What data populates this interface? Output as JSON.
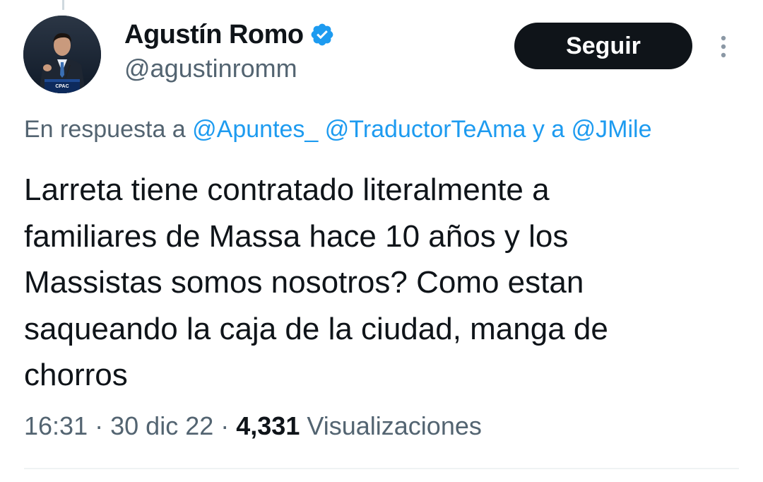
{
  "tweet": {
    "author": {
      "display_name": "Agustín Romo",
      "handle": "@agustinromm",
      "verified": true
    },
    "follow_label": "Seguir",
    "reply_prefix": "En respuesta a ",
    "reply_mentions": [
      "@Apuntes_",
      "@TraductorTeAma"
    ],
    "reply_conjunction": "y a",
    "reply_mention_last": "@JMile",
    "text": "Larreta tiene contratado literalmente a\nfamiliares de Massa hace 10 años y los\nMassistas somos nosotros? Como estan\nsaqueando la caja de la ciudad, manga de\nchorros",
    "time": "16:31",
    "date": "30 dic 22",
    "separator": "·",
    "view_count": "4,331",
    "view_label": "Visualizaciones"
  },
  "colors": {
    "text": "#0f1419",
    "secondary": "#536471",
    "link": "#1d9bf0",
    "verified": "#1d9bf0",
    "button_bg": "#0f1419",
    "button_text": "#ffffff"
  },
  "icons": {
    "verified": "verified-badge-icon",
    "more": "more-vertical-icon"
  }
}
